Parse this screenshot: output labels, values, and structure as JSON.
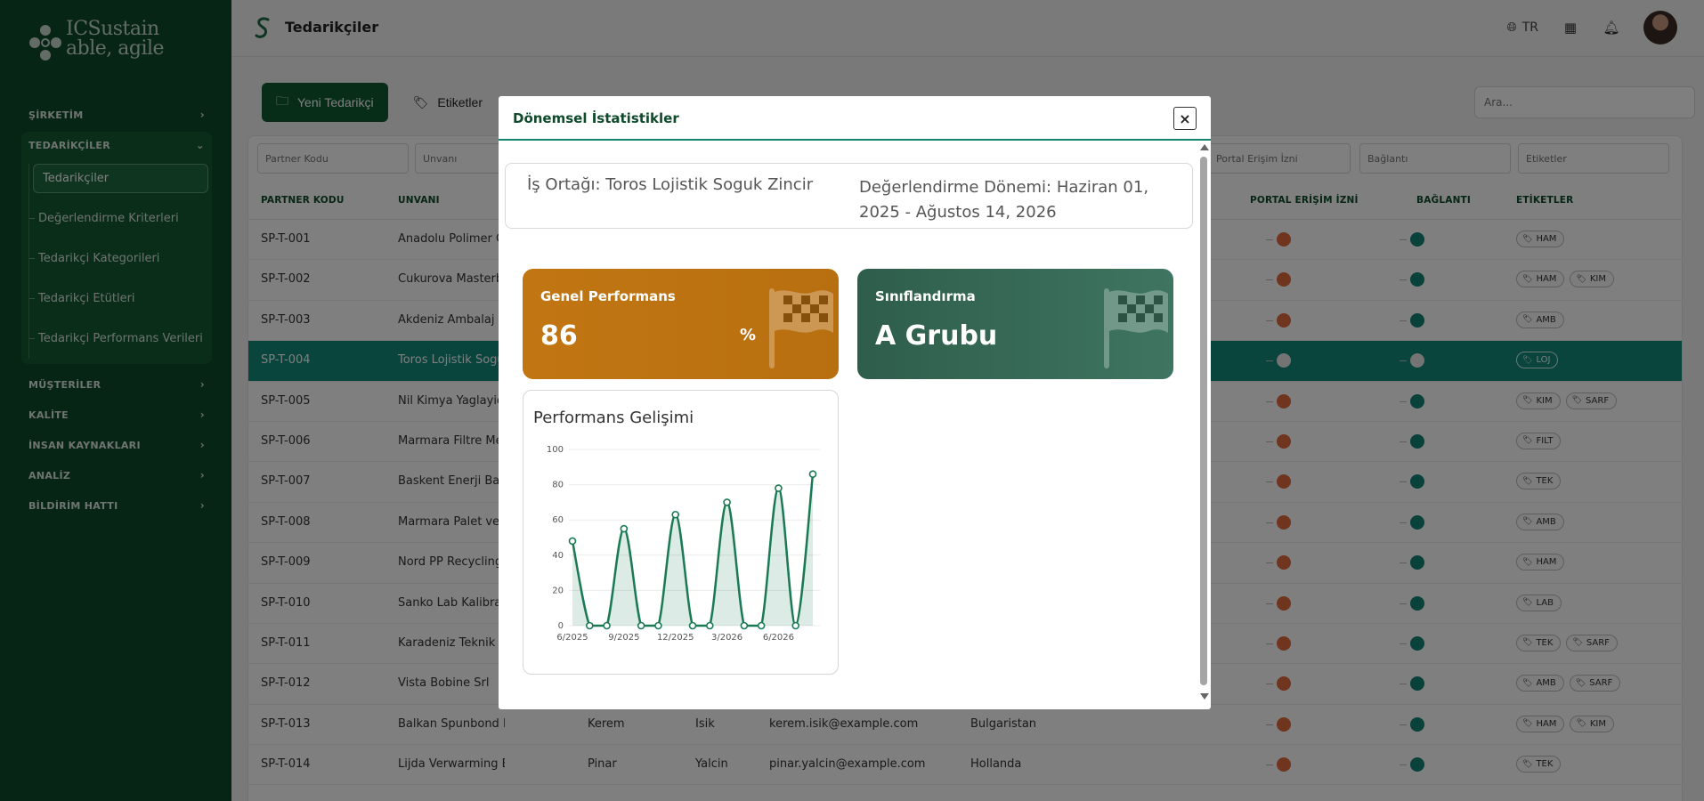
{
  "app": {
    "logo_text_line1": "ICSustain",
    "logo_text_line2": "able, agile",
    "page_title": "Tedarikçiler",
    "language": "TR"
  },
  "sidebar": {
    "sections": [
      {
        "label": "ŞİRKETİM"
      },
      {
        "label": "TEDARİKÇİLER",
        "expanded": true
      },
      {
        "label": "MÜŞTERİLER"
      },
      {
        "label": "KALİTE"
      },
      {
        "label": "İNSAN KAYNAKLARI"
      },
      {
        "label": "ANALİZ"
      },
      {
        "label": "BİLDİRİM HATTI"
      }
    ],
    "sub_items": [
      {
        "label": "Tedarikçiler",
        "active": true
      },
      {
        "label": "Değerlendirme Kriterleri"
      },
      {
        "label": "Tedarikçi Kategorileri"
      },
      {
        "label": "Tedarikçi Etütleri"
      },
      {
        "label": "Tedarikçi Performans Verileri"
      }
    ]
  },
  "toolbar": {
    "new_supplier_label": "Yeni Tedarikçi",
    "tags_label": "Etiketler",
    "search_placeholder": "Ara..."
  },
  "filters": {
    "partner_code": "Partner Kodu",
    "title": "Unvanı",
    "portal_access": "Portal Erişim İzni",
    "connection": "Bağlantı",
    "tags": "Etiketler"
  },
  "table": {
    "headers": {
      "partner_code": "PARTNER KODU",
      "title": "UNVANI",
      "portal_access": "PORTAL ERİŞİM İZNİ",
      "connection": "BAĞLANTI",
      "tags": "ETİKETLER"
    },
    "rows": [
      {
        "code": "SP-T-001",
        "title": "Anadolu Polimer Gı",
        "first": "",
        "last": "",
        "email": "",
        "country": "",
        "portal": "red",
        "conn": "teal",
        "tags": [
          "HAM"
        ]
      },
      {
        "code": "SP-T-002",
        "title": "Cukurova Masterba",
        "first": "",
        "last": "",
        "email": "",
        "country": "",
        "portal": "red",
        "conn": "teal",
        "tags": [
          "HAM",
          "KIM"
        ]
      },
      {
        "code": "SP-T-003",
        "title": "Akdeniz Ambalaj Sa",
        "first": "",
        "last": "",
        "email": "",
        "country": "",
        "portal": "red",
        "conn": "teal",
        "tags": [
          "AMB"
        ]
      },
      {
        "code": "SP-T-004",
        "title": "Toros Lojistik Sogu",
        "first": "",
        "last": "",
        "email": "",
        "country": "",
        "portal": "white",
        "conn": "white",
        "tags": [
          "LOJ"
        ],
        "selected": true
      },
      {
        "code": "SP-T-005",
        "title": "Nil Kimya Yaglayicıl",
        "first": "",
        "last": "",
        "email": "",
        "country": "",
        "portal": "red",
        "conn": "teal",
        "tags": [
          "KIM",
          "SARF"
        ]
      },
      {
        "code": "SP-T-006",
        "title": "Marmara Filtre Mes",
        "first": "",
        "last": "",
        "email": "",
        "country": "",
        "portal": "red",
        "conn": "teal",
        "tags": [
          "FILT"
        ]
      },
      {
        "code": "SP-T-007",
        "title": "Baskent Enerji Baki",
        "first": "",
        "last": "",
        "email": "",
        "country": "",
        "portal": "red",
        "conn": "teal",
        "tags": [
          "TEK"
        ]
      },
      {
        "code": "SP-T-008",
        "title": "Marmara Palet ve A",
        "first": "",
        "last": "",
        "email": "",
        "country": "",
        "portal": "red",
        "conn": "teal",
        "tags": [
          "AMB"
        ]
      },
      {
        "code": "SP-T-009",
        "title": "Nord PP Recycling",
        "first": "",
        "last": "",
        "email": "",
        "country": "",
        "portal": "red",
        "conn": "teal",
        "tags": [
          "HAM"
        ]
      },
      {
        "code": "SP-T-010",
        "title": "Sanko Lab Kalibras",
        "first": "",
        "last": "",
        "email": "",
        "country": "",
        "portal": "red",
        "conn": "teal",
        "tags": [
          "LAB"
        ]
      },
      {
        "code": "SP-T-011",
        "title": "Karadeniz Teknik Ye",
        "first": "",
        "last": "",
        "email": "",
        "country": "",
        "portal": "red",
        "conn": "teal",
        "tags": [
          "TEK",
          "SARF"
        ]
      },
      {
        "code": "SP-T-012",
        "title": "Vista Bobine Srl",
        "first": "",
        "last": "",
        "email": "",
        "country": "",
        "portal": "red",
        "conn": "teal",
        "tags": [
          "AMB",
          "SARF"
        ]
      },
      {
        "code": "SP-T-013",
        "title": "Balkan Spunbond EOOD",
        "first": "Kerem",
        "last": "Isik",
        "email": "kerem.isik@example.com",
        "country": "Bulgaristan",
        "portal": "red",
        "conn": "teal",
        "tags": [
          "HAM",
          "KIM"
        ]
      },
      {
        "code": "SP-T-014",
        "title": "Lijda Verwarming B.V.",
        "first": "Pinar",
        "last": "Yalcin",
        "email": "pinar.yalcin@example.com",
        "country": "Hollanda",
        "portal": "red",
        "conn": "teal",
        "tags": [
          "TEK"
        ]
      }
    ]
  },
  "modal": {
    "title": "Dönemsel İstatistikler",
    "close_label": "×",
    "partner_text": "İş Ortağı: Toros Lojistik Soguk Zincir",
    "period_text": "Değerlendirme Dönemi: Haziran 01, 2025 - Ağustos 14, 2026",
    "kpi_performance": {
      "label": "Genel Performans",
      "value": "86",
      "unit": "%"
    },
    "kpi_class": {
      "label": "Sınıflandırma",
      "value": "A Grubu"
    },
    "chart_title": "Performans Gelişimi"
  },
  "colors": {
    "sidebar_bg": "#0f4a2a",
    "accent_teal": "#138376",
    "kpi_orange": "#c17612",
    "kpi_green": "#2e5e4b",
    "status_red": "#e06a3f"
  },
  "chart_data": {
    "type": "area",
    "title": "Performans Gelişimi",
    "xlabel": "",
    "ylabel": "",
    "ylim": [
      0,
      100
    ],
    "yticks": [
      0,
      20,
      40,
      60,
      80,
      100
    ],
    "xtick_labels": [
      "6/2025",
      "9/2025",
      "12/2025",
      "3/2026",
      "6/2026"
    ],
    "x": [
      "6/2025",
      "7/2025",
      "8/2025",
      "9/2025",
      "10/2025",
      "11/2025",
      "12/2025",
      "1/2026",
      "2/2026",
      "3/2026",
      "4/2026",
      "5/2026",
      "6/2026",
      "7/2026",
      "8/2026"
    ],
    "values": [
      48,
      0,
      0,
      55,
      0,
      0,
      63,
      0,
      0,
      70,
      0,
      0,
      78,
      0,
      86
    ],
    "grid": true,
    "legend": false
  }
}
